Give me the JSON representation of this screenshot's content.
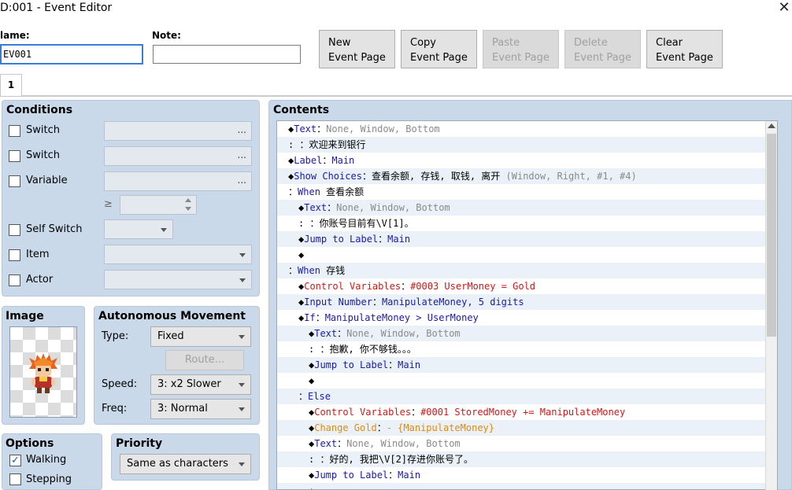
{
  "window": {
    "title": "D:001 - Event Editor",
    "close_icon": "close-icon"
  },
  "fields": {
    "name_label": "lame:",
    "name_value": "EV001",
    "note_label": "Note:",
    "note_value": ""
  },
  "buttons": {
    "new_l1": "New",
    "new_l2": "Event Page",
    "copy_l1": "Copy",
    "copy_l2": "Event Page",
    "paste_l1": "Paste",
    "paste_l2": "Event Page",
    "delete_l1": "Delete",
    "delete_l2": "Event Page",
    "clear_l1": "Clear",
    "clear_l2": "Event Page"
  },
  "tabs": [
    {
      "label": "1"
    }
  ],
  "conditions": {
    "title": "Conditions",
    "switch1": "Switch",
    "switch2": "Switch",
    "variable": "Variable",
    "gte": "≥",
    "self_switch": "Self Switch",
    "item": "Item",
    "actor": "Actor",
    "ellipsis": "..."
  },
  "image": {
    "title": "Image",
    "icon": "character-sprite-icon"
  },
  "movement": {
    "title": "Autonomous Movement",
    "type_label": "Type:",
    "type_value": "Fixed",
    "route_label": "Route...",
    "speed_label": "Speed:",
    "speed_value": "3: x2 Slower",
    "freq_label": "Freq:",
    "freq_value": "3: Normal"
  },
  "options": {
    "title": "Options",
    "walking": "Walking",
    "walking_checked": true,
    "stepping": "Stepping",
    "stepping_checked": false
  },
  "priority": {
    "title": "Priority",
    "value": "Same as characters"
  },
  "contents": {
    "title": "Contents",
    "lines": [
      {
        "i": 0,
        "parts": [
          [
            "sc",
            "◆"
          ],
          [
            "blue",
            "Text"
          ],
          [
            "sc",
            "："
          ],
          [
            "gray",
            "None, Window, Bottom"
          ]
        ]
      },
      {
        "i": 0,
        "parts": [
          [
            "sc",
            ":      ："
          ],
          [
            "sc",
            "欢迎来到银行"
          ]
        ]
      },
      {
        "i": 0,
        "parts": [
          [
            "sc",
            "◆"
          ],
          [
            "blue",
            "Label"
          ],
          [
            "sc",
            "："
          ],
          [
            "blue",
            "Main"
          ]
        ]
      },
      {
        "i": 0,
        "parts": [
          [
            "sc",
            "◆"
          ],
          [
            "blue",
            "Show Choices"
          ],
          [
            "sc",
            "："
          ],
          [
            "sc",
            "查看余额, 存钱, 取钱, 离开 "
          ],
          [
            "gray",
            "(Window, Right, #1, #4)"
          ]
        ]
      },
      {
        "i": 0,
        "parts": [
          [
            "sc",
            "："
          ],
          [
            "blue",
            "When "
          ],
          [
            "sc",
            "查看余额"
          ]
        ]
      },
      {
        "i": 1,
        "parts": [
          [
            "sc",
            "◆"
          ],
          [
            "blue",
            "Text"
          ],
          [
            "sc",
            "："
          ],
          [
            "gray",
            "None, Window, Bottom"
          ]
        ]
      },
      {
        "i": 1,
        "parts": [
          [
            "sc",
            ":      ："
          ],
          [
            "sc",
            "你账号目前有\\V[1]。"
          ]
        ]
      },
      {
        "i": 1,
        "parts": [
          [
            "sc",
            "◆"
          ],
          [
            "blue",
            "Jump to Label"
          ],
          [
            "sc",
            "："
          ],
          [
            "blue",
            "Main"
          ]
        ]
      },
      {
        "i": 1,
        "parts": [
          [
            "sc",
            "◆"
          ]
        ]
      },
      {
        "i": 0,
        "parts": [
          [
            "sc",
            "："
          ],
          [
            "blue",
            "When "
          ],
          [
            "sc",
            "存钱"
          ]
        ]
      },
      {
        "i": 1,
        "parts": [
          [
            "sc",
            "◆"
          ],
          [
            "red",
            "Control Variables"
          ],
          [
            "sc",
            "："
          ],
          [
            "red",
            "#0003 UserMoney = Gold"
          ]
        ]
      },
      {
        "i": 1,
        "parts": [
          [
            "sc",
            "◆"
          ],
          [
            "blue",
            "Input Number"
          ],
          [
            "sc",
            "："
          ],
          [
            "blue",
            "ManipulateMoney, 5 digits"
          ]
        ]
      },
      {
        "i": 1,
        "parts": [
          [
            "sc",
            "◆"
          ],
          [
            "blue",
            "If"
          ],
          [
            "sc",
            "："
          ],
          [
            "blue",
            "ManipulateMoney > UserMoney"
          ]
        ]
      },
      {
        "i": 2,
        "parts": [
          [
            "sc",
            "◆"
          ],
          [
            "blue",
            "Text"
          ],
          [
            "sc",
            "："
          ],
          [
            "gray",
            "None, Window, Bottom"
          ]
        ]
      },
      {
        "i": 2,
        "parts": [
          [
            "sc",
            ":      ："
          ],
          [
            "sc",
            "抱歉, 你不够钱。。。"
          ]
        ]
      },
      {
        "i": 2,
        "parts": [
          [
            "sc",
            "◆"
          ],
          [
            "blue",
            "Jump to Label"
          ],
          [
            "sc",
            "："
          ],
          [
            "blue",
            "Main"
          ]
        ]
      },
      {
        "i": 2,
        "parts": [
          [
            "sc",
            "◆"
          ]
        ]
      },
      {
        "i": 1,
        "parts": [
          [
            "sc",
            "："
          ],
          [
            "blue",
            "Else"
          ]
        ]
      },
      {
        "i": 2,
        "parts": [
          [
            "sc",
            "◆"
          ],
          [
            "red",
            "Control Variables"
          ],
          [
            "sc",
            "："
          ],
          [
            "red",
            "#0001 StoredMoney += ManipulateMoney"
          ]
        ]
      },
      {
        "i": 2,
        "parts": [
          [
            "sc",
            "◆"
          ],
          [
            "orange",
            "Change Gold"
          ],
          [
            "sc",
            "："
          ],
          [
            "orange",
            "- {ManipulateMoney}"
          ]
        ]
      },
      {
        "i": 2,
        "parts": [
          [
            "sc",
            "◆"
          ],
          [
            "blue",
            "Text"
          ],
          [
            "sc",
            "："
          ],
          [
            "gray",
            "None, Window, Bottom"
          ]
        ]
      },
      {
        "i": 2,
        "parts": [
          [
            "sc",
            ":      ："
          ],
          [
            "sc",
            "好的, 我把\\V[2]存进你账号了。"
          ]
        ]
      },
      {
        "i": 2,
        "parts": [
          [
            "sc",
            "◆"
          ],
          [
            "blue",
            "Jump to Label"
          ],
          [
            "sc",
            "："
          ],
          [
            "blue",
            "Main"
          ]
        ]
      },
      {
        "i": 2,
        "parts": [
          [
            "sc",
            "◆"
          ]
        ]
      }
    ]
  }
}
